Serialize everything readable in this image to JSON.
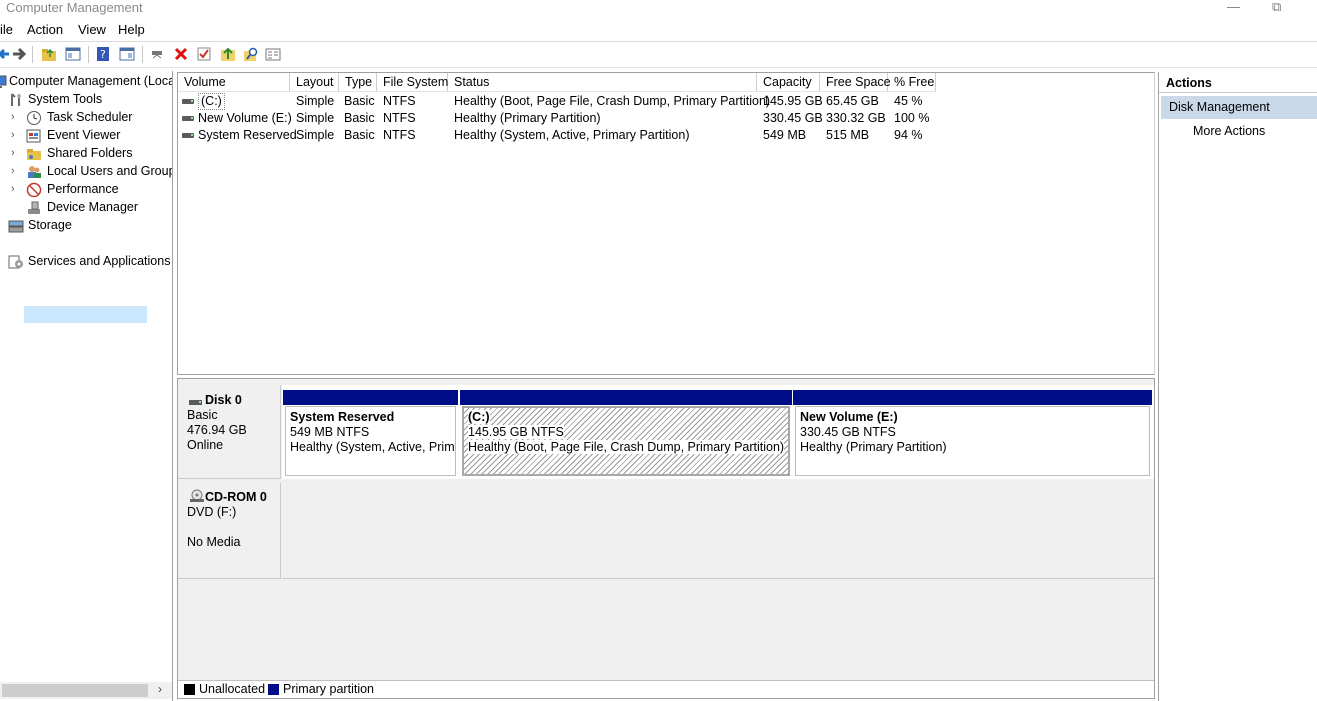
{
  "window": {
    "title": "Computer Management"
  },
  "menu": [
    "ile",
    "Action",
    "View",
    "Help"
  ],
  "toolbar_icons": [
    "back-arrow-icon",
    "forward-arrow-icon",
    "up-folder-icon",
    "show-hide-tree-icon",
    "help-icon",
    "show-hide-action-pane-icon",
    "connect-icon",
    "delete-icon",
    "check-icon",
    "up-icon",
    "find-icon",
    "properties-icon"
  ],
  "tree": {
    "root": "Computer Management (Local",
    "system_tools": "System Tools",
    "task_scheduler": "Task Scheduler",
    "event_viewer": "Event Viewer",
    "shared_folders": "Shared Folders",
    "local_users": "Local Users and Groups",
    "performance": "Performance",
    "device_manager": "Device Manager",
    "storage": "Storage",
    "services": "Services and Applications"
  },
  "volume_table": {
    "columns": [
      "Volume",
      "Layout",
      "Type",
      "File System",
      "Status",
      "Capacity",
      "Free Space",
      "% Free"
    ],
    "rows": [
      {
        "volume": "(C:)",
        "layout": "Simple",
        "type": "Basic",
        "fs": "NTFS",
        "status": "Healthy (Boot, Page File, Crash Dump, Primary Partition)",
        "capacity": "145.95 GB",
        "free": "65.45 GB",
        "pct": "45 %"
      },
      {
        "volume": "New Volume (E:)",
        "layout": "Simple",
        "type": "Basic",
        "fs": "NTFS",
        "status": "Healthy (Primary Partition)",
        "capacity": "330.45 GB",
        "free": "330.32 GB",
        "pct": "100 %"
      },
      {
        "volume": "System Reserved",
        "layout": "Simple",
        "type": "Basic",
        "fs": "NTFS",
        "status": "Healthy (System, Active, Primary Partition)",
        "capacity": "549 MB",
        "free": "515 MB",
        "pct": "94 %"
      }
    ]
  },
  "disk0": {
    "name": "Disk 0",
    "type": "Basic",
    "size": "476.94 GB",
    "state": "Online",
    "partitions": [
      {
        "name": "System Reserved",
        "size": "549 MB NTFS",
        "status": "Healthy (System, Active, Prima"
      },
      {
        "name": "(C:)",
        "size": "145.95 GB NTFS",
        "status": "Healthy (Boot, Page File, Crash Dump, Primary Partition)"
      },
      {
        "name": "New Volume  (E:)",
        "size": "330.45 GB NTFS",
        "status": "Healthy (Primary Partition)"
      }
    ]
  },
  "cdrom0": {
    "name": "CD-ROM 0",
    "drive": "DVD (F:)",
    "media": "No Media"
  },
  "legend": {
    "items": [
      {
        "label": "Unallocated",
        "color": "#000000"
      },
      {
        "label": "Primary partition",
        "color": "#000d89"
      }
    ]
  },
  "actions": {
    "header": "Actions",
    "section": "Disk Management",
    "more": "More Actions"
  }
}
